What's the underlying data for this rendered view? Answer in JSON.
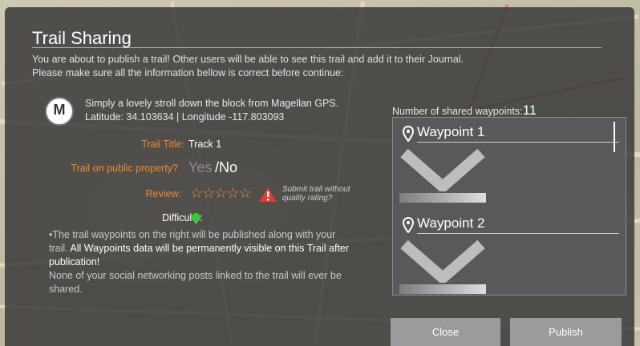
{
  "dialog": {
    "title": "Trail Sharing",
    "intro_line1": "You are about to publish a trail! Other users will be able to see this trail and add it to their Journal.",
    "intro_line2": "Please make sure all the information bellow is correct before continue:"
  },
  "source": {
    "logo_letter": "M",
    "description": "Simply a lovely stroll down the block from Magellan GPS.",
    "coordinates": "Latitude: 34.103634 | Longitude -117.803093"
  },
  "fields": {
    "title_label": "Trail Title:",
    "title_value": "Track 1",
    "public_label": "Trail on public property?",
    "public_yes": "Yes",
    "public_no": "/No",
    "review_label": "Review:",
    "review_stars": "☆☆☆☆☆",
    "submit_without_line1": "Submit trail without",
    "submit_without_line2": "quality rating?",
    "difficulty_label": "Difficulty:",
    "difficulty_color": "#34cc34"
  },
  "note": {
    "part1": "•The trail waypoints on the right will be published along with your trail.",
    "part2": "All Waypoints data will be permanently visible on this Trail after publication!",
    "part3": "None of your social networking posts linked to the trail will ever be shared."
  },
  "waypoints": {
    "count_label": "Number of shared waypoints:",
    "count": "11",
    "items": [
      {
        "name": "Waypoint 1",
        "icon": "location-pin-icon"
      },
      {
        "name": "Waypoint 2",
        "icon": "location-pin-icon"
      }
    ]
  },
  "buttons": {
    "close": "Close",
    "publish": "Publish"
  },
  "colors": {
    "accent": "#f08b2c",
    "warning": "#e53935"
  }
}
